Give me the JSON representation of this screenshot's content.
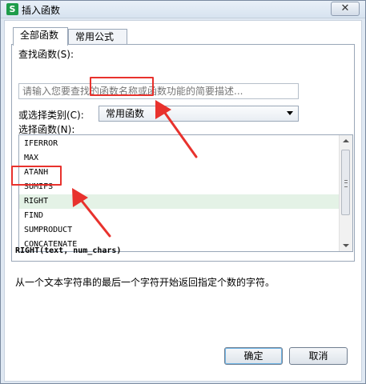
{
  "window": {
    "title": "插入函数",
    "app_icon_glyph": "S",
    "close_glyph": "✕"
  },
  "tabs": [
    {
      "label": "全部函数",
      "active": true
    },
    {
      "label": "常用公式",
      "active": false
    }
  ],
  "search": {
    "label": "查找函数(S):",
    "placeholder": "请输入您要查找的函数名称或函数功能的简要描述..."
  },
  "category": {
    "label": "或选择类别(C):",
    "selected": "常用函数"
  },
  "functions": {
    "label": "选择函数(N):",
    "items": [
      "IFERROR",
      "MAX",
      "ATANH",
      "SUMIFS",
      "RIGHT",
      "FIND",
      "SUMPRODUCT",
      "CONCATENATE"
    ],
    "selected_index": 4
  },
  "signature": "RIGHT(text, num_chars)",
  "description": "从一个文本字符串的最后一个字符开始返回指定个数的字符。",
  "buttons": {
    "ok": "确定",
    "cancel": "取消"
  },
  "colors": {
    "annotation_red": "#e8322d",
    "selection_green": "#e4f2e6"
  }
}
